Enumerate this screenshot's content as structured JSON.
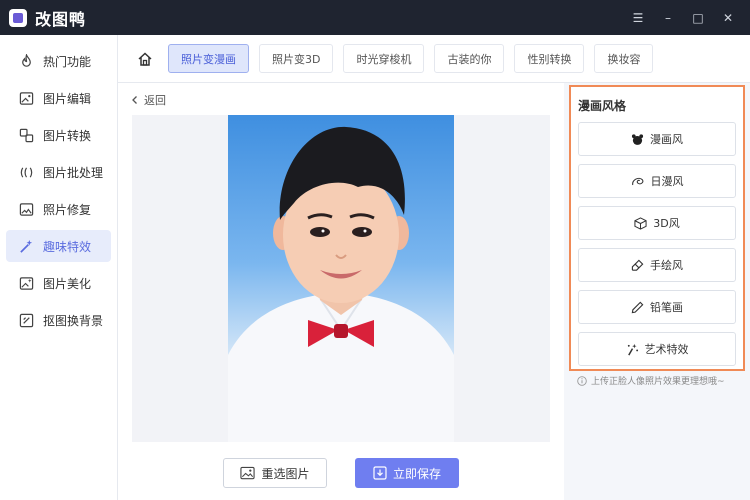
{
  "app": {
    "title": "改图鸭"
  },
  "window_controls": {
    "menu": "☰",
    "minimize": "–",
    "maximize": "□",
    "close": "✕"
  },
  "sidebar": {
    "items": [
      {
        "label": "热门功能",
        "icon": "flame-icon"
      },
      {
        "label": "图片编辑",
        "icon": "image-edit-icon"
      },
      {
        "label": "图片转换",
        "icon": "convert-icon"
      },
      {
        "label": "图片批处理",
        "icon": "batch-icon"
      },
      {
        "label": "照片修复",
        "icon": "photo-repair-icon"
      },
      {
        "label": "趣味特效",
        "icon": "magic-wand-icon",
        "active": true
      },
      {
        "label": "图片美化",
        "icon": "beautify-icon"
      },
      {
        "label": "抠图换背景",
        "icon": "cutout-icon"
      }
    ]
  },
  "tabs": [
    {
      "label": "照片变漫画",
      "active": true
    },
    {
      "label": "照片变3D"
    },
    {
      "label": "时光穿梭机"
    },
    {
      "label": "古装的你"
    },
    {
      "label": "性别转换"
    },
    {
      "label": "换妆容"
    }
  ],
  "content": {
    "back_label": "返回",
    "reselect_label": "重选图片",
    "save_label": "立即保存"
  },
  "style_panel": {
    "title": "漫画风格",
    "options": [
      {
        "label": "漫画风",
        "icon": "bear-icon"
      },
      {
        "label": "日漫风",
        "icon": "swirl-icon"
      },
      {
        "label": "3D风",
        "icon": "cube-icon"
      },
      {
        "label": "手绘风",
        "icon": "eraser-icon"
      },
      {
        "label": "铅笔画",
        "icon": "pencil-icon"
      },
      {
        "label": "艺术特效",
        "icon": "sparkle-wand-icon"
      }
    ],
    "hint": "上传正脸人像照片效果更理想哦~"
  },
  "colors": {
    "accent": "#6f7ef0",
    "highlight_border": "#f08a56",
    "titlebar": "#1f2430"
  }
}
